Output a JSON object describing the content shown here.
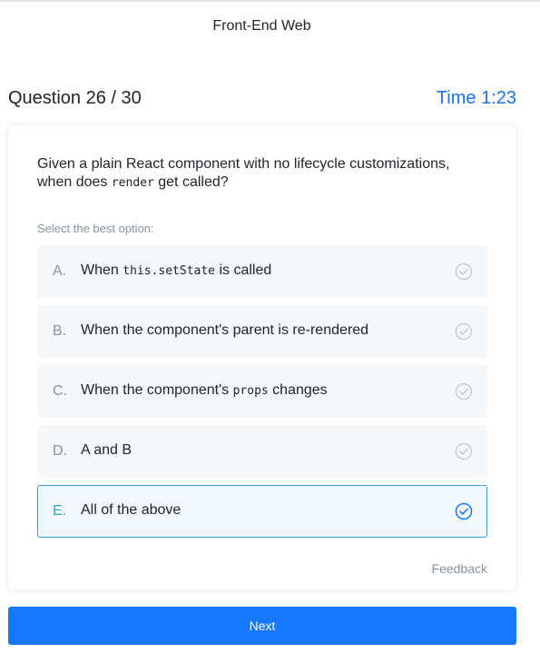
{
  "header": {
    "app_title": "Front-End Web",
    "question_counter": "Question 26 / 30",
    "timer": "Time 1:23"
  },
  "question": {
    "text_before_code": "Given a plain React component with no lifecycle customizations, when does ",
    "code": "render",
    "text_after_code": " get called?",
    "hint": "Select the best option:"
  },
  "options": [
    {
      "letter": "A.",
      "parts": [
        "When ",
        "this.setState",
        " is called"
      ],
      "selected": false,
      "icon": "check-circle-icon"
    },
    {
      "letter": "B.",
      "parts": [
        "When the component's parent is re-rendered"
      ],
      "selected": false,
      "icon": "check-circle-icon"
    },
    {
      "letter": "C.",
      "parts": [
        "When the component's ",
        "props",
        " changes"
      ],
      "selected": false,
      "icon": "check-circle-icon"
    },
    {
      "letter": "D.",
      "parts": [
        "A and B"
      ],
      "selected": false,
      "icon": "check-circle-icon"
    },
    {
      "letter": "E.",
      "parts": [
        "All of the above"
      ],
      "selected": true,
      "icon": "check-circle-icon"
    }
  ],
  "footer": {
    "feedback_label": "Feedback",
    "next_label": "Next"
  },
  "colors": {
    "accent": "#1677ff",
    "timer": "#1a73e8",
    "selected_border": "#3c9bd3",
    "check_idle": "#c4c9cf"
  }
}
